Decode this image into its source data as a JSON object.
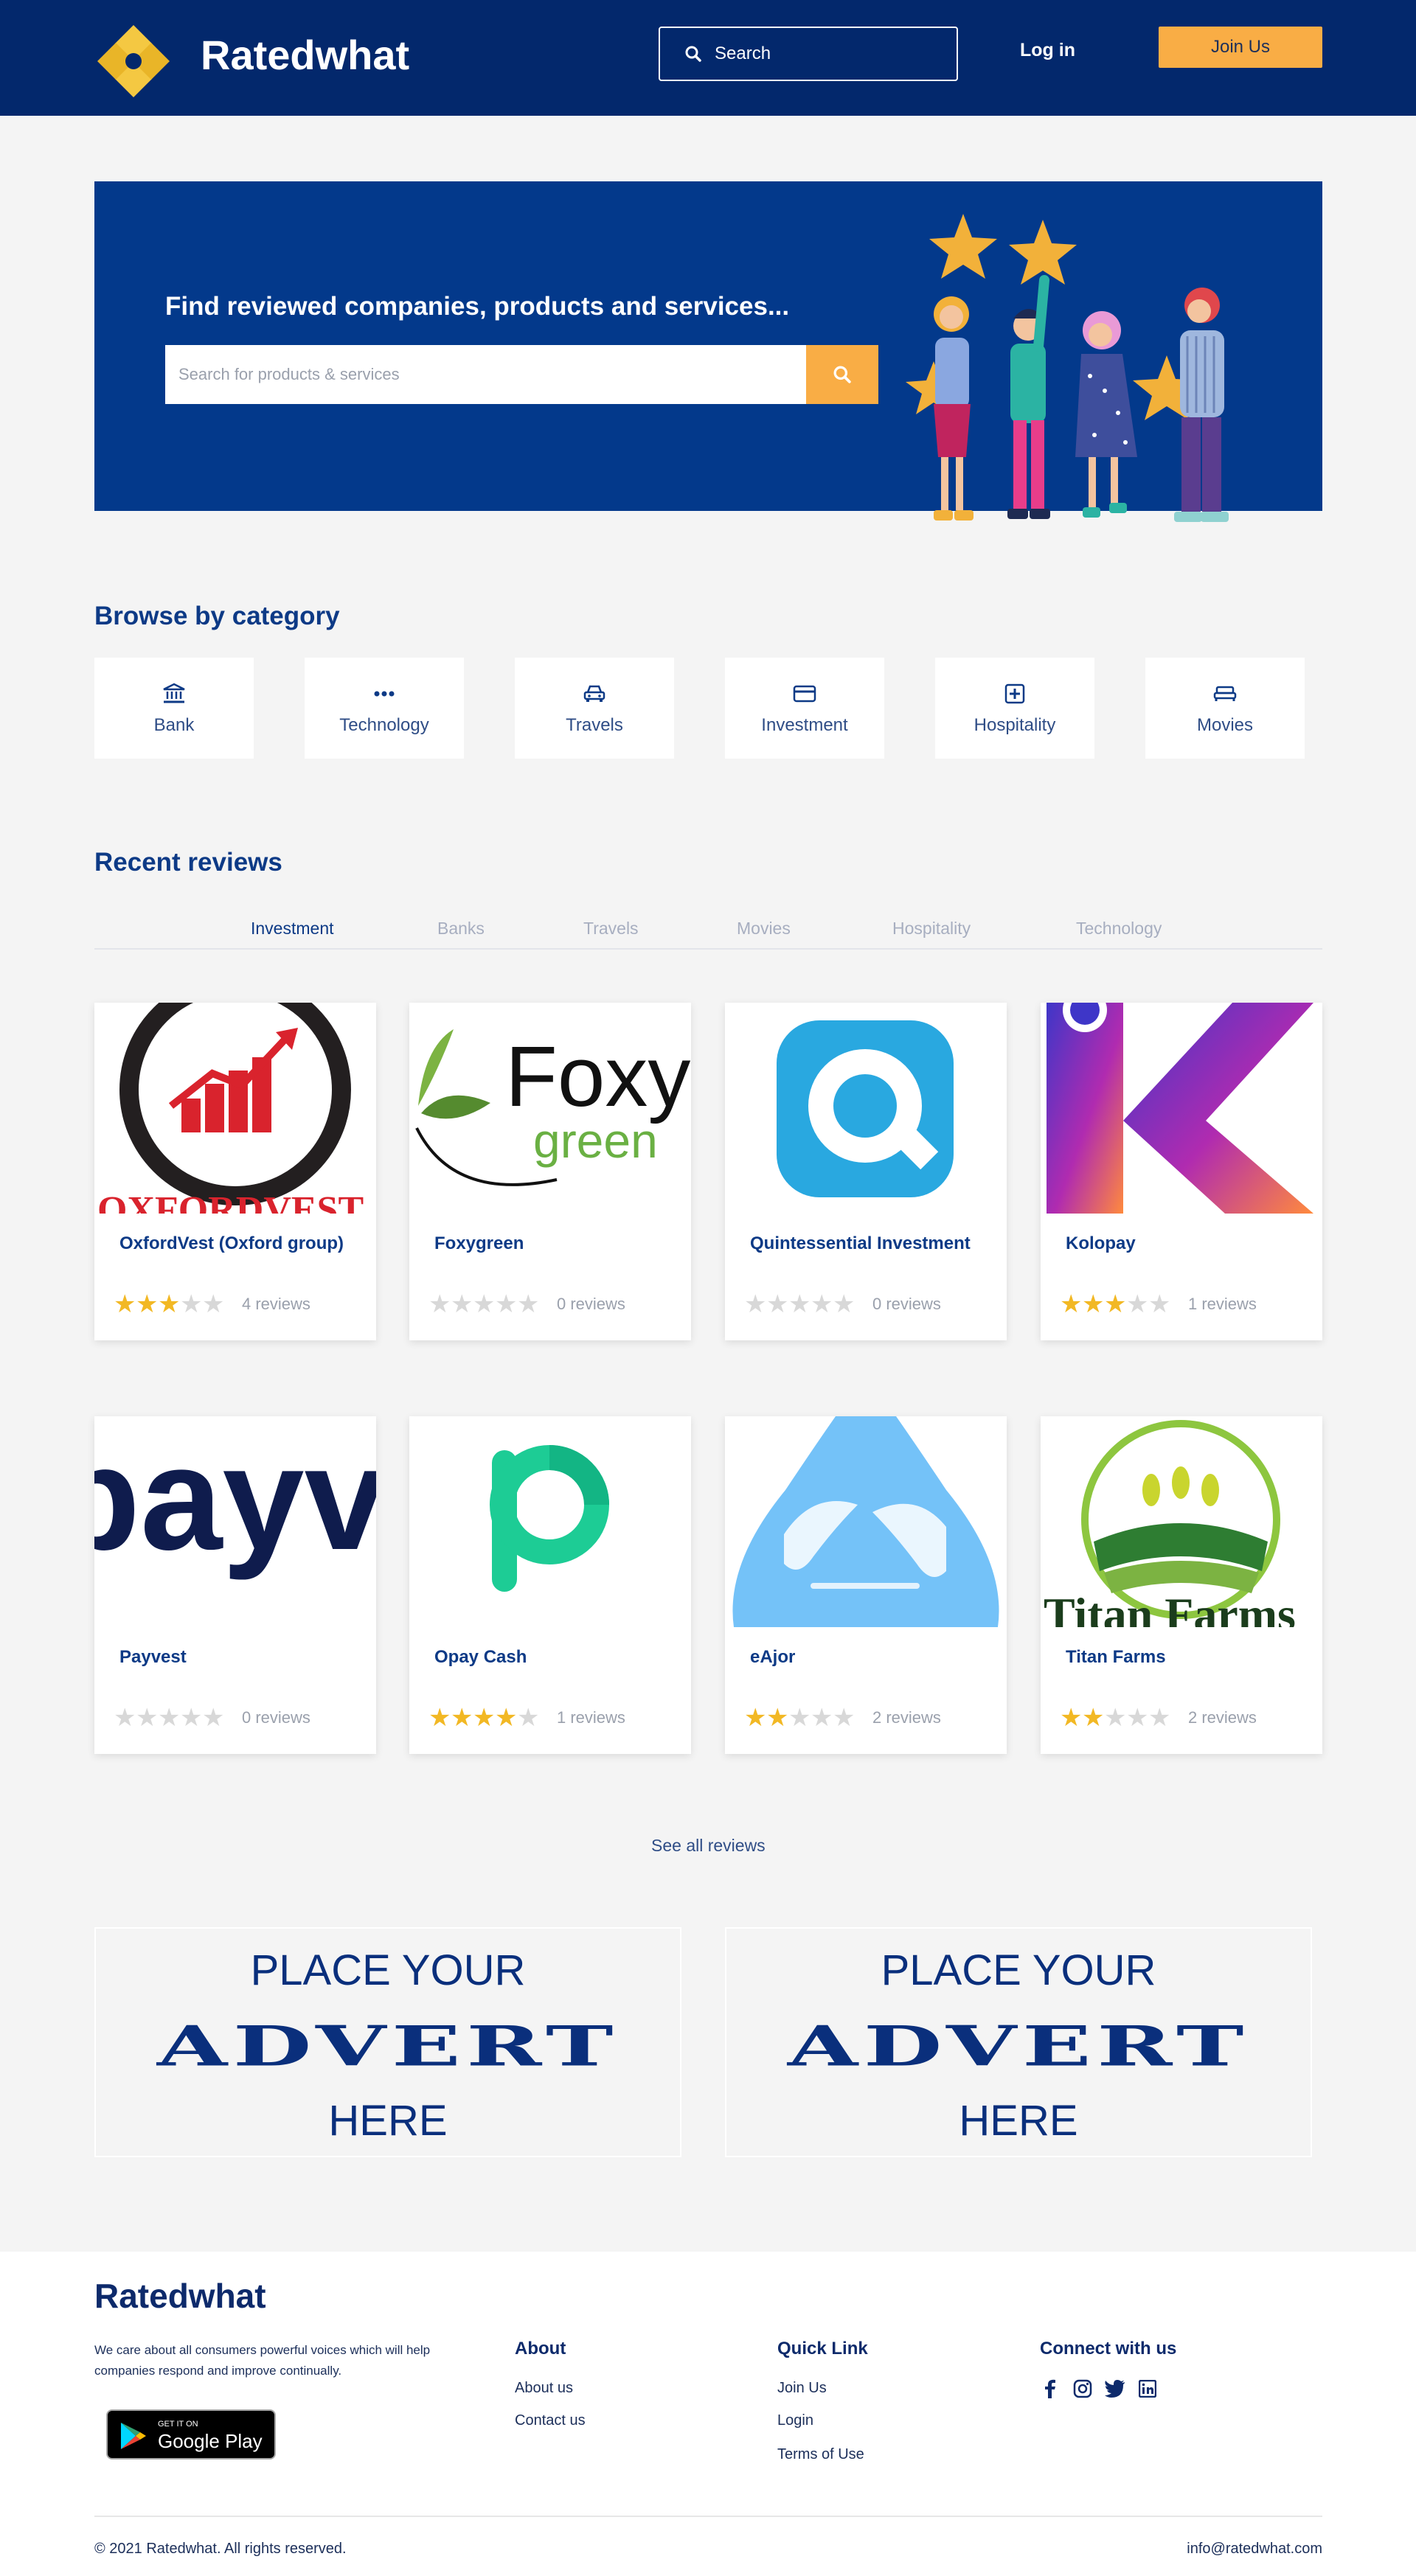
{
  "colors": {
    "navy": "#03286c",
    "hero_blue": "#03398b",
    "accent_orange": "#f9ad45",
    "star_gold": "#f2b824"
  },
  "header": {
    "brand": "Ratedwhat",
    "search_label": "Search",
    "login_label": "Log in",
    "join_label": "Join Us"
  },
  "hero": {
    "title": "Find reviewed companies, products and services...",
    "search_placeholder": "Search for products & services"
  },
  "categories": {
    "title": "Browse by category",
    "items": [
      {
        "label": "Bank",
        "icon": "bank-icon"
      },
      {
        "label": "Technology",
        "icon": "more-dots-icon"
      },
      {
        "label": "Travels",
        "icon": "car-icon"
      },
      {
        "label": "Investment",
        "icon": "card-icon"
      },
      {
        "label": "Hospitality",
        "icon": "medical-plus-icon"
      },
      {
        "label": "Movies",
        "icon": "bed-icon"
      }
    ]
  },
  "reviews": {
    "title": "Recent reviews",
    "tabs": [
      "Investment",
      "Banks",
      "Travels",
      "Movies",
      "Hospitality",
      "Technology"
    ],
    "active_tab": "Investment",
    "cards": [
      {
        "name": "OxfordVest (Oxford group)",
        "rating": 3,
        "count": "4 reviews",
        "logo": "oxfordvest-logo",
        "logo_text": "OXFORDVEST"
      },
      {
        "name": "Foxygreen",
        "rating": 0,
        "count": "0 reviews",
        "logo": "foxygreen-logo",
        "logo_text": "Foxy",
        "logo_sub": "green"
      },
      {
        "name": "Quintessential Investment",
        "rating": 0,
        "count": "0 reviews",
        "logo": "quintessential-logo"
      },
      {
        "name": "Kolopay",
        "rating": 3,
        "count": "1 reviews",
        "logo": "kolopay-logo"
      },
      {
        "name": "Payvest",
        "rating": 0,
        "count": "0 reviews",
        "logo": "payvest-logo",
        "logo_text": "payv"
      },
      {
        "name": "Opay Cash",
        "rating": 4,
        "count": "1 reviews",
        "logo": "opay-logo"
      },
      {
        "name": "eAjor",
        "rating": 2,
        "count": "2 reviews",
        "logo": "eajor-logo"
      },
      {
        "name": "Titan Farms",
        "rating": 2,
        "count": "2 reviews",
        "logo": "titanfarms-logo",
        "logo_text": "Titan Farms"
      }
    ],
    "see_all": "See all reviews"
  },
  "adverts": [
    {
      "top": "PLACE YOUR",
      "middle": "ADVERT",
      "bottom": "HERE"
    },
    {
      "top": "PLACE YOUR",
      "middle": "ADVERT",
      "bottom": "HERE"
    }
  ],
  "footer": {
    "brand": "Ratedwhat",
    "about_text": "We care about all consumers powerful voices which will help companies respond and improve continually.",
    "gplay_small": "GET IT ON",
    "gplay_big": "Google Play",
    "col_about": {
      "title": "About",
      "links": [
        "About us",
        "Contact us"
      ]
    },
    "col_quick": {
      "title": "Quick Link",
      "links": [
        "Join Us",
        "Login",
        "Terms of Use"
      ]
    },
    "col_connect": {
      "title": "Connect with us",
      "icons": [
        "facebook-icon",
        "instagram-icon",
        "twitter-icon",
        "linkedin-icon"
      ]
    },
    "copyright": "© 2021 Ratedwhat. All rights reserved.",
    "email": "info@ratedwhat.com"
  }
}
